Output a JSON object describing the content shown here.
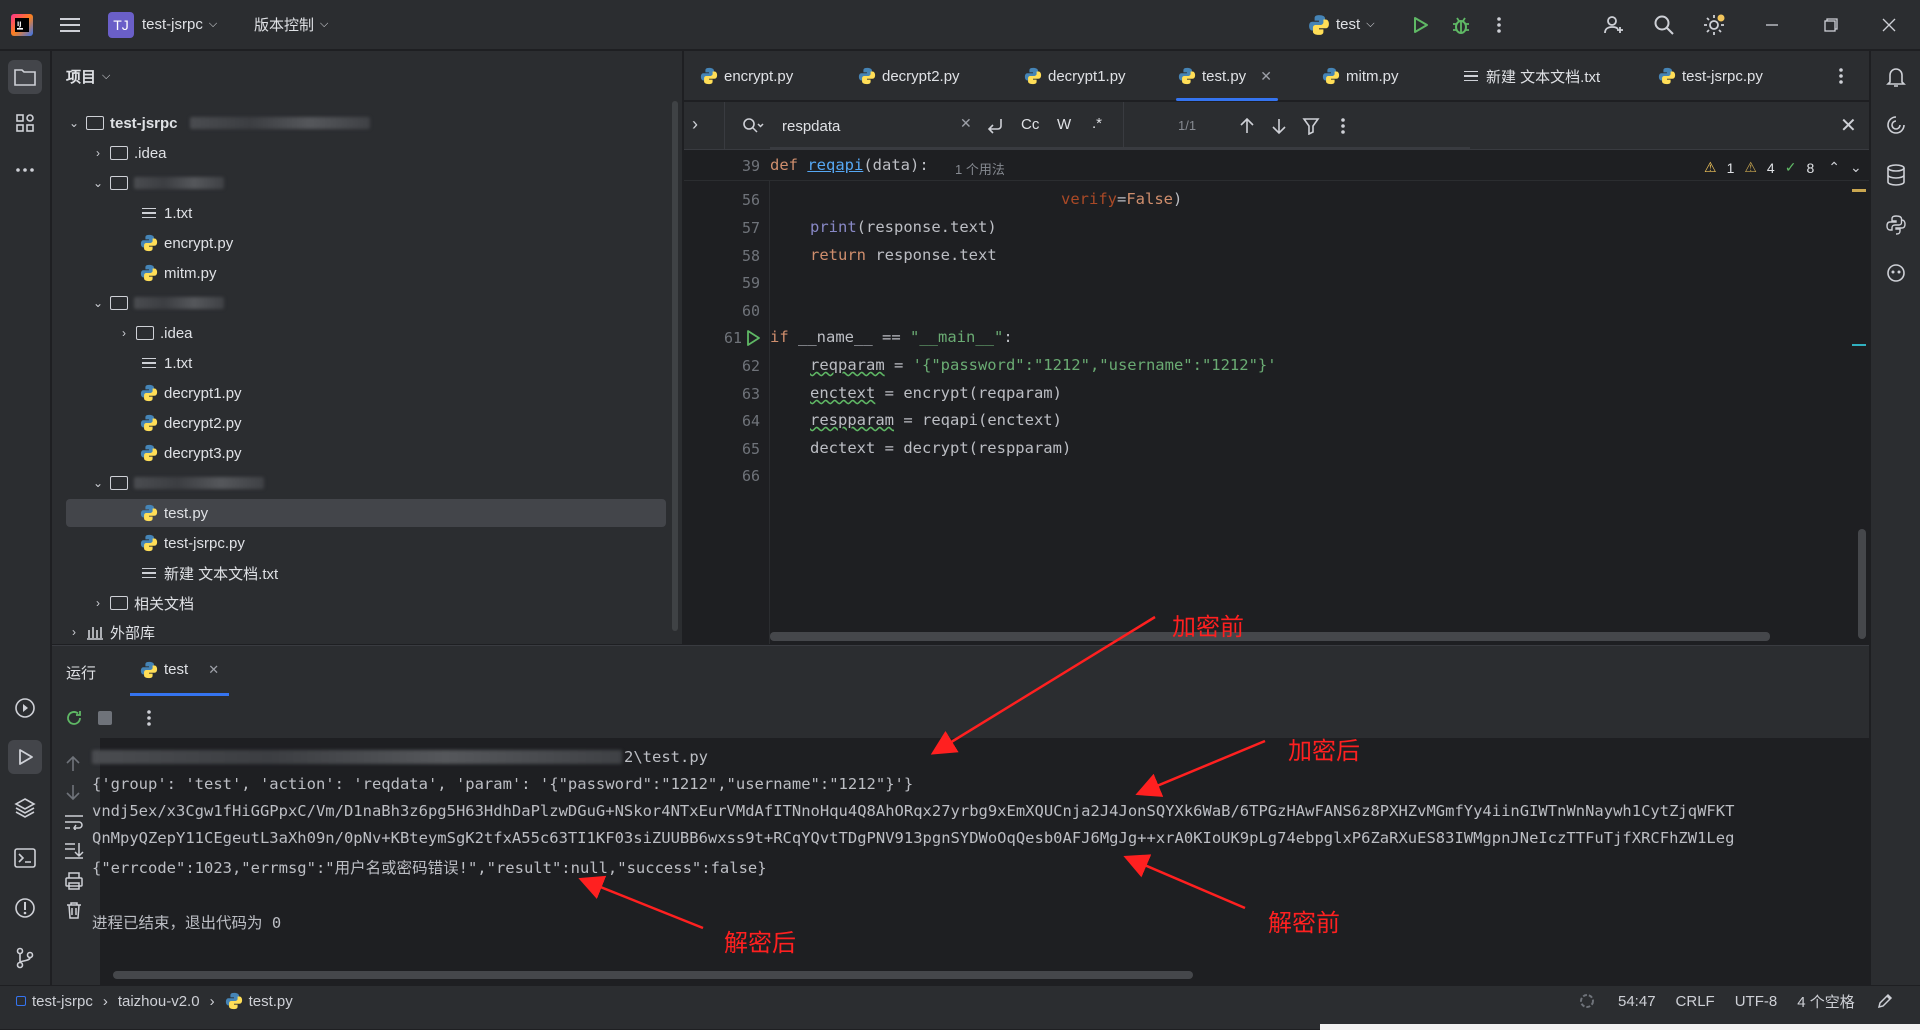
{
  "titlebar": {
    "logo": "jetbrains-logo",
    "project_badge": "TJ",
    "project_name": "test-jsrpc",
    "vcs_label": "版本控制",
    "run_config": "test"
  },
  "project_panel": {
    "title": "项目",
    "root": "test-jsrpc",
    "items": [
      {
        "label": ".idea",
        "type": "folder"
      },
      {
        "label": "1.txt",
        "type": "txt"
      },
      {
        "label": "encrypt.py",
        "type": "py"
      },
      {
        "label": "mitm.py",
        "type": "py"
      },
      {
        "label": ".idea",
        "type": "folder"
      },
      {
        "label": "1.txt",
        "type": "txt"
      },
      {
        "label": "decrypt1.py",
        "type": "py"
      },
      {
        "label": "decrypt2.py",
        "type": "py"
      },
      {
        "label": "decrypt3.py",
        "type": "py"
      },
      {
        "label": "test.py",
        "type": "py"
      },
      {
        "label": "test-jsrpc.py",
        "type": "py"
      },
      {
        "label": "新建 文本文档.txt",
        "type": "txt"
      },
      {
        "label": "相关文档",
        "type": "folder"
      },
      {
        "label": "外部库",
        "type": "lib"
      }
    ]
  },
  "tabs": [
    {
      "label": "encrypt.py"
    },
    {
      "label": "decrypt2.py"
    },
    {
      "label": "decrypt1.py"
    },
    {
      "label": "test.py",
      "active": true
    },
    {
      "label": "mitm.py"
    },
    {
      "label": "新建 文本文档.txt"
    },
    {
      "label": "test-jsrpc.py"
    }
  ],
  "search": {
    "query": "respdata",
    "match_case": "Cc",
    "words": "W",
    "regex": ".*",
    "count": "1/1"
  },
  "editor": {
    "sticky_line": "39",
    "sticky_code_kw": "def ",
    "sticky_code_fn": "reqapi",
    "sticky_code_rest": "(data):",
    "sticky_usage": "1 个用法",
    "warnings": "1",
    "weak_warnings": "4",
    "ok_count": "8",
    "lines": [
      {
        "n": "56"
      },
      {
        "n": "57"
      },
      {
        "n": "58"
      },
      {
        "n": "59"
      },
      {
        "n": "60"
      },
      {
        "n": "61"
      },
      {
        "n": "62"
      },
      {
        "n": "63"
      },
      {
        "n": "64"
      },
      {
        "n": "65"
      },
      {
        "n": "66"
      }
    ],
    "code": {
      "l56_a": "verify",
      "l56_b": "=",
      "l56_c": "False",
      "l56_d": ")",
      "l57_a": "print",
      "l57_b": "(response.text)",
      "l58_a": "return",
      "l58_b": " response.text",
      "l61_a": "if",
      "l61_b": " __name__ == ",
      "l61_c": "\"__main__\"",
      "l61_d": ":",
      "l62_a": "reqparam",
      "l62_b": " = ",
      "l62_c": "'{\"password\":\"1212\",\"username\":\"1212\"}'",
      "l63_a": "enctext",
      "l63_b": " = encrypt(reqparam)",
      "l64_a": "respparam",
      "l64_b": " = reqapi(enctext)",
      "l65_a": "dectext",
      "l65_b": " = decrypt(respparam)"
    }
  },
  "run_panel": {
    "title": "运行",
    "tab_label": "test",
    "console": {
      "path_tail": "2\\test.py",
      "line1": "{'group': 'test', 'action': 'reqdata', 'param': '{\"password\":\"1212\",\"username\":\"1212\"}'}",
      "line2": "vndj5ex/x3Cgw1fHiGGPpxC/Vm/D1naBh3z6pg5H63HdhDaPlzwDGuG+NSkor4NTxEurVMdAfITNnoHqu4Q8AhORqx27yrbg9xEmXQUCnja2J4JonSQYXk6WaB/6TPGzHAwFANS6z8PXHZvMGmfYy4iinGIWTnWnNaywh1CytZjqWFKT",
      "line3": "QnMpyQZepY11CEgeutL3aXh09n/0pNv+KBteymSgK2tfxA55c63TI1KF03siZUUBB6wxss9t+RCqYQvtTDgPNV913pgnSYDWoOqQesb0AFJ6MgJg++xrA0KIoUK9pLg74ebpglxP6ZaRXuES83IWMgpnJNeIczTTFuTjfXRCFhZW1Leg",
      "line4": "{\"errcode\":1023,\"errmsg\":\"用户名或密码错误!\",\"result\":null,\"success\":false}",
      "line5": "进程已结束，退出代码为 0"
    }
  },
  "annotations": {
    "before_encrypt": "加密前",
    "after_encrypt": "加密后",
    "before_decrypt": "解密前",
    "after_decrypt": "解密后",
    "color": "#ff2020"
  },
  "statusbar": {
    "crumb1": "test-jsrpc",
    "crumb2": "taizhou-v2.0",
    "crumb3": "test.py",
    "position": "54:47",
    "line_sep": "CRLF",
    "encoding": "UTF-8",
    "indent": "4 个空格"
  },
  "colors": {
    "accent": "#3574f0",
    "python_blue": "#4584b6",
    "python_yellow": "#ffde57",
    "run_green": "#5fb865"
  }
}
